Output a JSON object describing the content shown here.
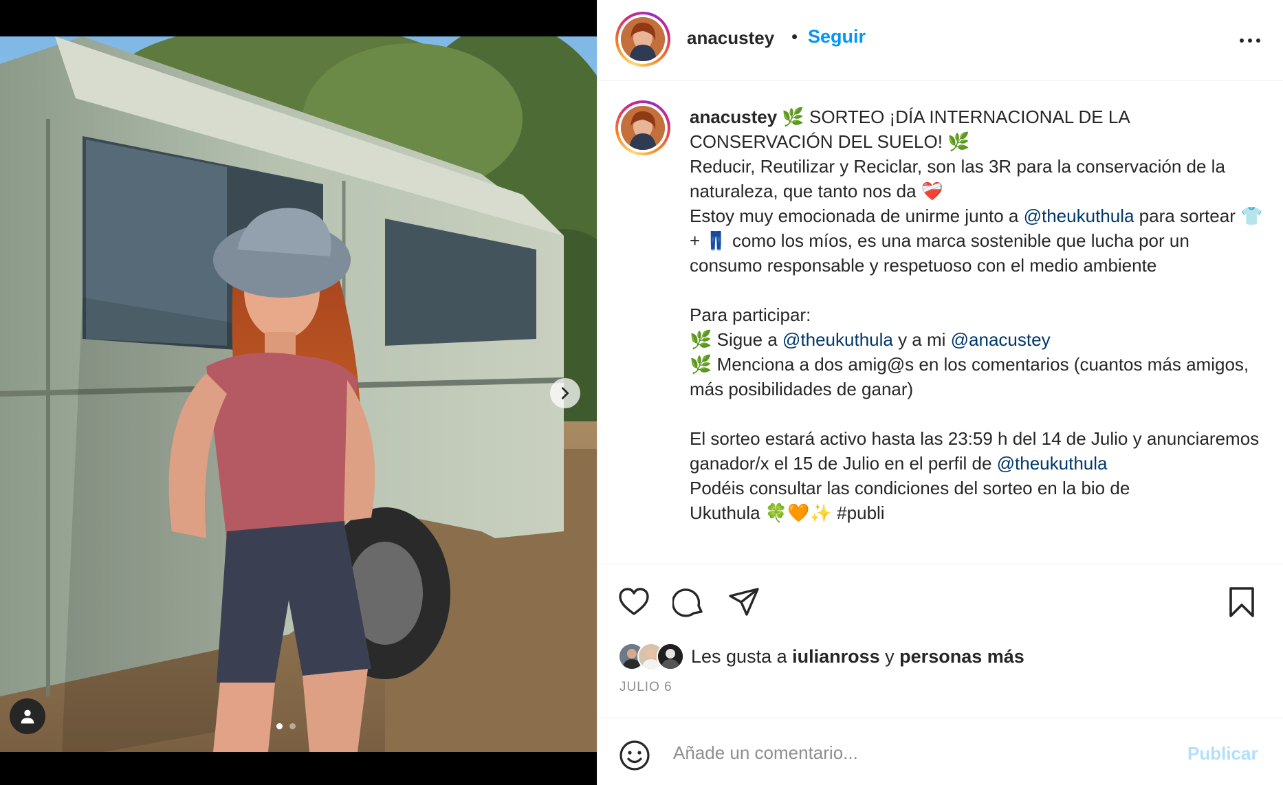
{
  "media": {
    "tag_icon": "user-tag-icon",
    "next_icon": "chevron-right-icon",
    "carousel_total": 2,
    "carousel_active": 1
  },
  "header": {
    "username": "anacustey",
    "separator": "•",
    "follow_label": "Seguir",
    "more_icon": "more-horizontal-icon"
  },
  "caption": {
    "username": "anacustey",
    "title": " 🌿 SORTEO ¡DÍA INTERNACIONAL DE LA CONSERVACIÓN DEL SUELO! 🌿",
    "p1": "Reducir, Reutilizar y Reciclar, son las 3R para la conservación de la naturaleza, que tanto nos da ❤️‍🩹",
    "p2_a": "Estoy muy emocionada de unirme junto a ",
    "p2_mention": "@theukuthula",
    "p2_b": " para sortear 👕 + 👖 como los míos, es una marca sostenible que lucha por un consumo responsable y respetuoso con el medio ambiente",
    "p3": "Para participar:",
    "p4_a": "🌿 Sigue a ",
    "p4_mention1": "@theukuthula",
    "p4_b": " y a mi ",
    "p4_mention2": "@anacustey",
    "p5": "🌿 Menciona a dos amig@s en los comentarios (cuantos más amigos, más posibilidades de ganar)",
    "p6_a": "El sorteo estará activo hasta las 23:59 h del 14 de Julio y anunciaremos ganador/x el 15 de Julio en el perfil de ",
    "p6_mention": "@theukuthula",
    "p7": "Podéis consultar las condiciones del sorteo en la bio de",
    "p8": "Ukuthula 🍀🧡✨ #publi"
  },
  "actions": {
    "like_icon": "heart-icon",
    "comment_icon": "comment-icon",
    "share_icon": "share-icon",
    "save_icon": "bookmark-icon"
  },
  "likes": {
    "prefix": "Les gusta a ",
    "user": "iulianross",
    "middle": " y ",
    "others": "personas más"
  },
  "date": "JULIO 6",
  "comment": {
    "emoji_icon": "emoji-icon",
    "placeholder": "Añade un comentario...",
    "publish_label": "Publicar"
  },
  "colors": {
    "link_blue": "#0095f6",
    "mention": "#00376b",
    "publish_disabled": "#b2dffc",
    "muted": "#8e8e8e"
  }
}
